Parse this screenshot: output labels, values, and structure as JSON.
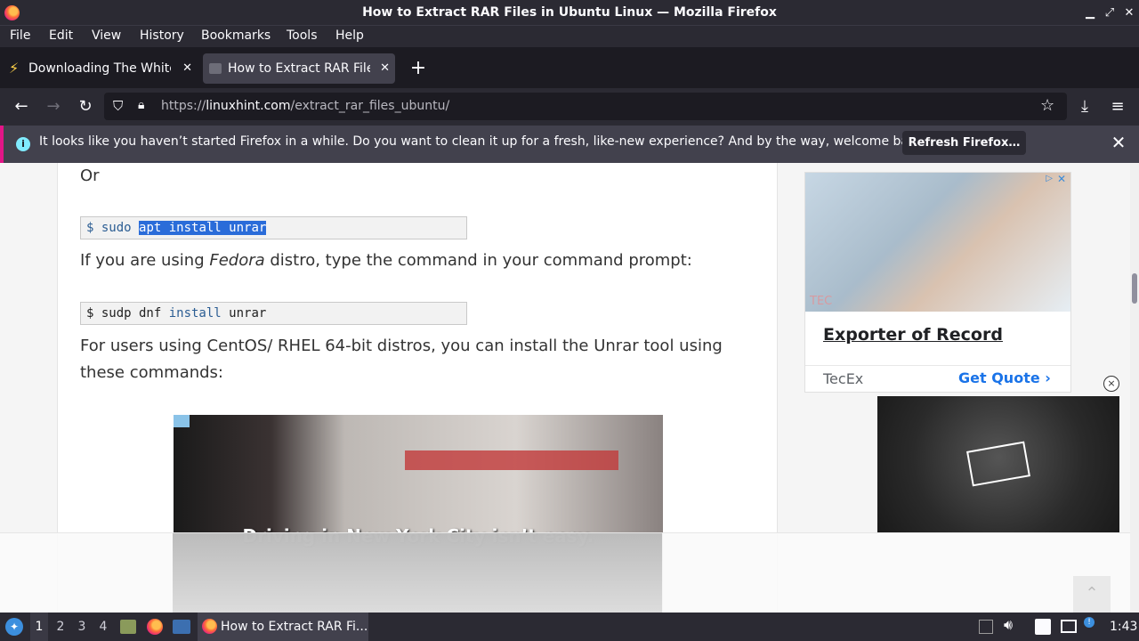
{
  "window": {
    "title": "How to Extract RAR Files in Ubuntu Linux — Mozilla Firefox"
  },
  "menu": [
    "File",
    "Edit",
    "View",
    "History",
    "Bookmarks",
    "Tools",
    "Help"
  ],
  "tabs": [
    {
      "label": "Downloading The White",
      "active": false
    },
    {
      "label": "How to Extract RAR Files",
      "active": true
    }
  ],
  "url": {
    "prefix": "https://",
    "domain": "linuxhint.com",
    "path": "/extract_rar_files_ubuntu/"
  },
  "notification": {
    "text": "It looks like you haven’t started Firefox in a while. Do you want to clean it up for a fresh, like-new experience? And by the way, welcome back!",
    "button": "Refresh Firefox…"
  },
  "article": {
    "or": "Or",
    "cmd1_prompt": "$ sudo ",
    "cmd1_selected": "apt install unrar",
    "para1_before": "If you are using ",
    "para1_em": "Fedora",
    "para1_after": " distro, type the command in your command prompt:",
    "cmd2_prompt": "$ sudp dnf ",
    "cmd2_kw": "install",
    "cmd2_rest": " unrar",
    "para2_line1": "For users using CentOS/ RHEL 64-bit distros, you can install the Unrar tool using",
    "para2_line2": "these commands:",
    "video_caption": "Driving in New York City isn’t easy."
  },
  "ad": {
    "brand_watermark": "TEC",
    "headline": "Exporter of Record",
    "company": "TecEx",
    "cta": "Get Quote"
  },
  "taskbar": {
    "workspaces": [
      "1",
      "2",
      "3",
      "4"
    ],
    "active_window": "How to Extract RAR Fi...",
    "clock": "1:43"
  }
}
